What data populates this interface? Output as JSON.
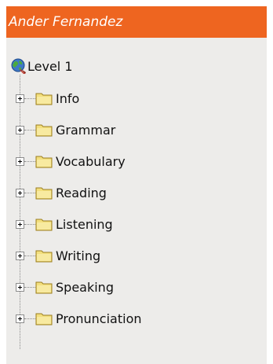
{
  "header": {
    "title": "Ander Fernandez"
  },
  "tree": {
    "root": {
      "label": "Level 1",
      "icon": "globe-icon"
    },
    "items": [
      {
        "label": "Info",
        "icon": "folder-icon"
      },
      {
        "label": "Grammar",
        "icon": "folder-icon"
      },
      {
        "label": "Vocabulary",
        "icon": "folder-icon"
      },
      {
        "label": "Reading",
        "icon": "folder-icon"
      },
      {
        "label": "Listening",
        "icon": "folder-icon"
      },
      {
        "label": "Writing",
        "icon": "folder-icon"
      },
      {
        "label": "Speaking",
        "icon": "folder-icon"
      },
      {
        "label": "Pronunciation",
        "icon": "folder-icon"
      }
    ]
  },
  "colors": {
    "header_background": "#ee6520",
    "panel_background": "#edecea",
    "folder_fill": "#f3df7e"
  }
}
